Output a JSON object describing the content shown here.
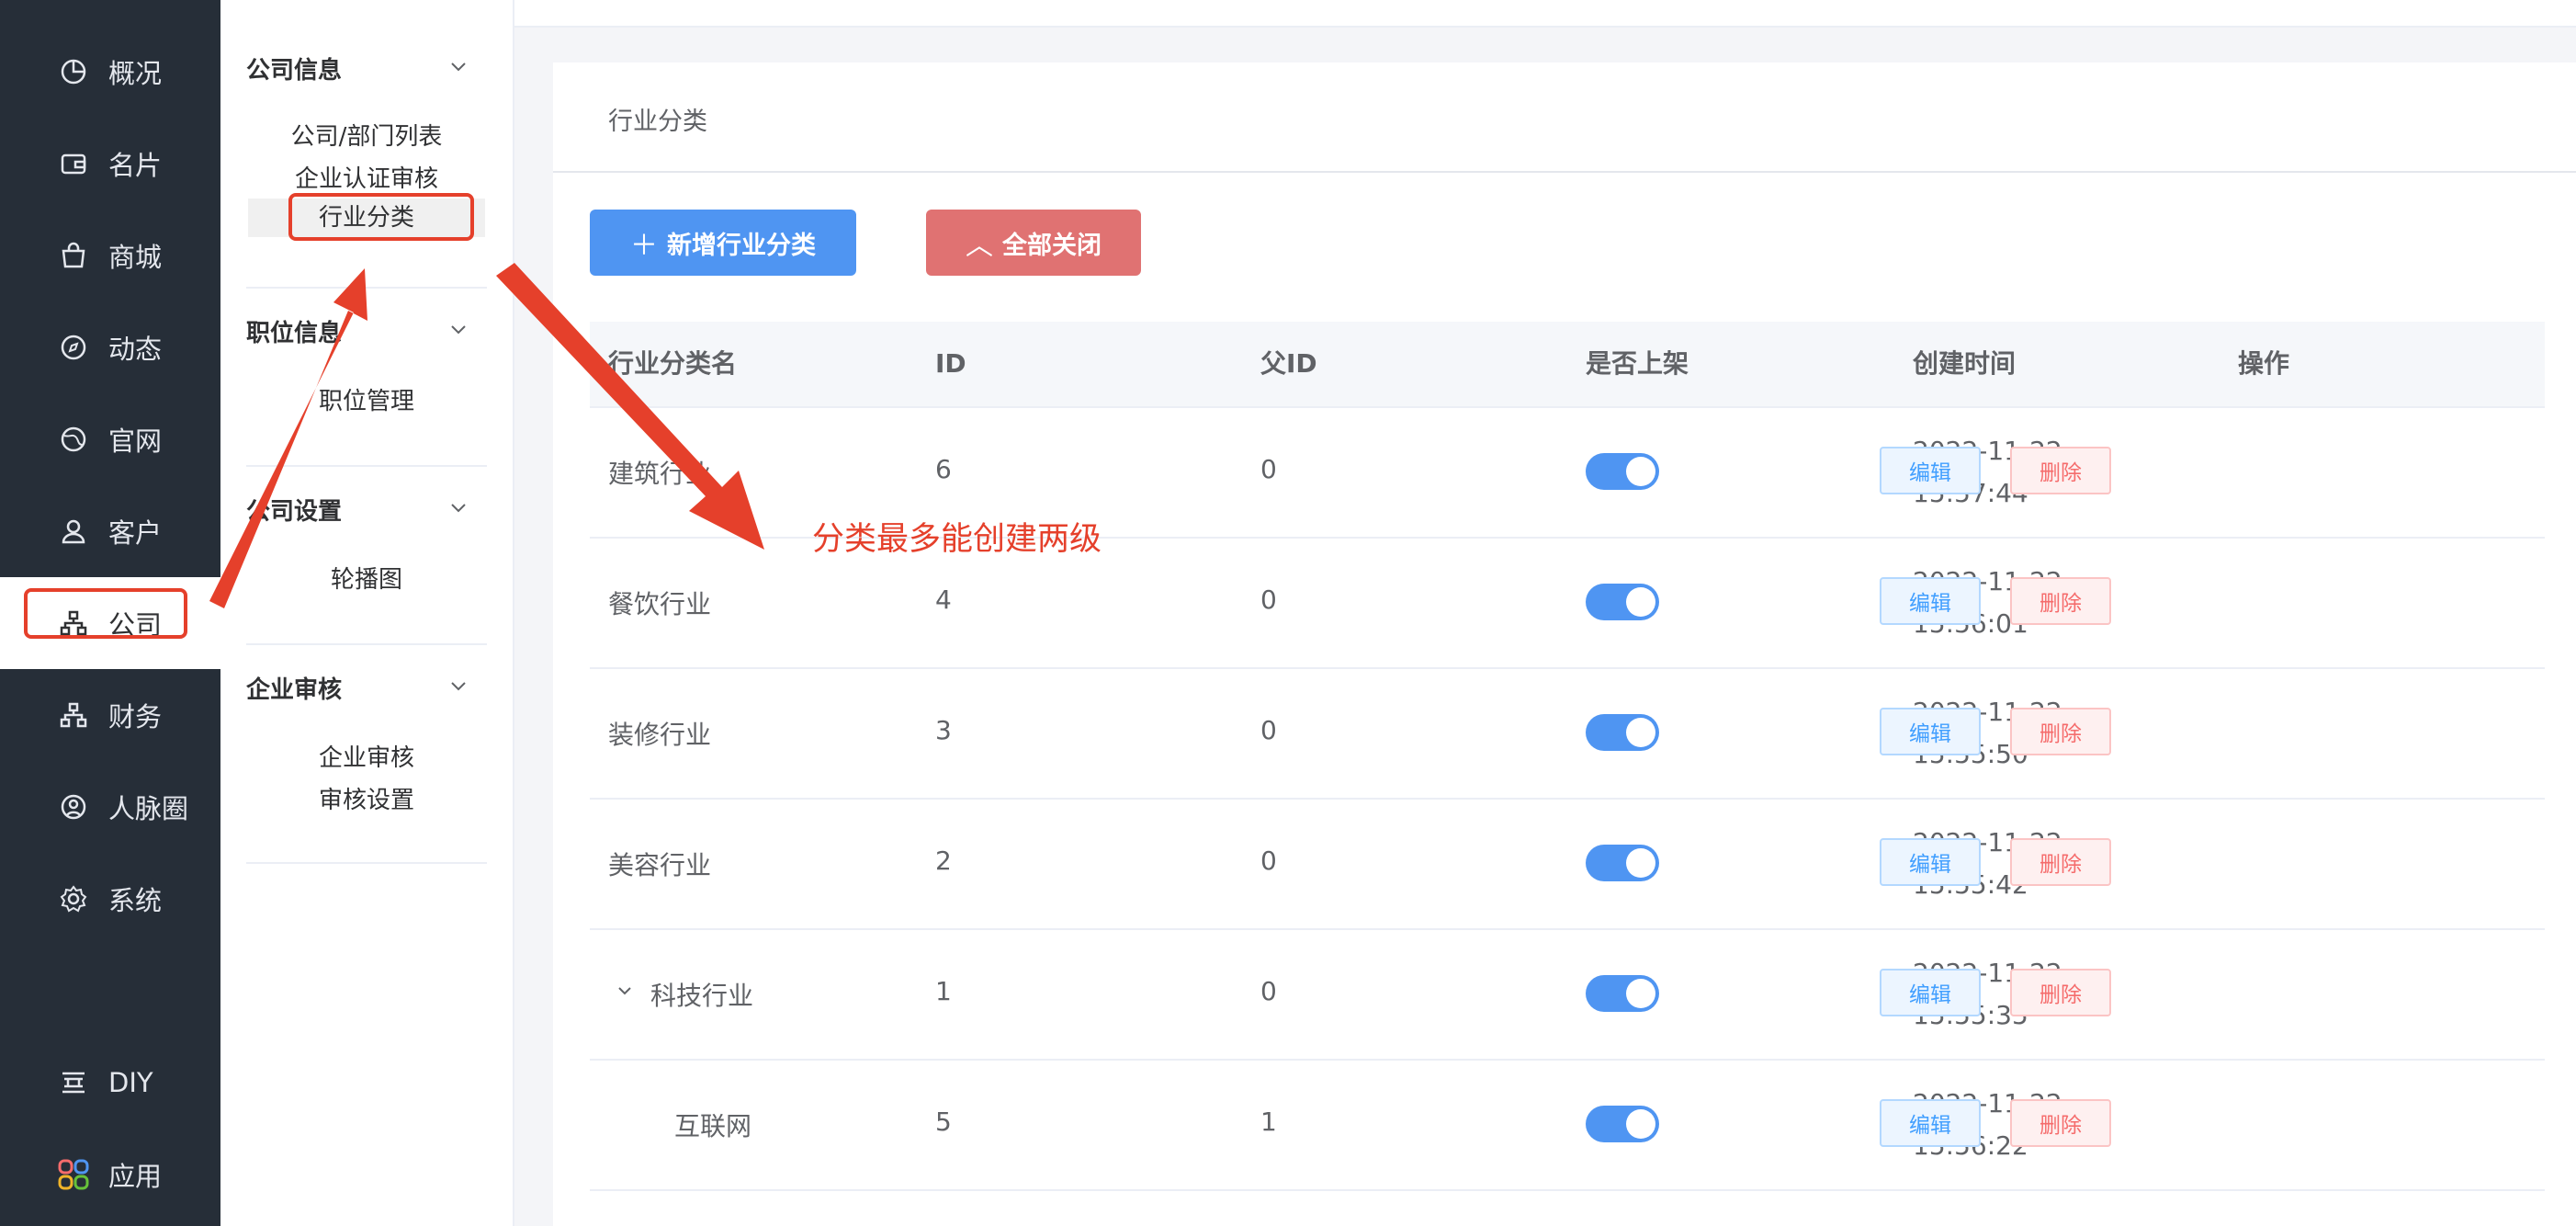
{
  "rail": {
    "items": [
      {
        "label": "概况",
        "icon": "pie-chart-icon"
      },
      {
        "label": "名片",
        "icon": "wallet-icon"
      },
      {
        "label": "商城",
        "icon": "shopping-bag-icon"
      },
      {
        "label": "动态",
        "icon": "compass-icon"
      },
      {
        "label": "官网",
        "icon": "globe-icon"
      },
      {
        "label": "客户",
        "icon": "user-icon"
      },
      {
        "label": "公司",
        "icon": "org-chart-icon"
      },
      {
        "label": "财务",
        "icon": "org-chart-icon"
      },
      {
        "label": "人脉圈",
        "icon": "user-circle-icon"
      },
      {
        "label": "系统",
        "icon": "gear-icon"
      }
    ],
    "bottom": [
      {
        "label": "DIY",
        "icon": "layout-icon"
      },
      {
        "label": "应用",
        "icon": "apps-icon"
      }
    ],
    "active": "公司"
  },
  "submenu": {
    "groups": [
      {
        "title": "公司信息",
        "items": [
          "公司/部门列表",
          "企业认证审核",
          "行业分类"
        ]
      },
      {
        "title": "职位信息",
        "items": [
          "职位管理"
        ]
      },
      {
        "title": "公司设置",
        "items": [
          "轮播图"
        ]
      },
      {
        "title": "企业审核",
        "items": [
          "企业审核",
          "审核设置"
        ]
      }
    ],
    "selected": "行业分类"
  },
  "panel": {
    "title": "行业分类",
    "add_button": "新增行业分类",
    "add_icon": "＋",
    "close_button": "全部关闭",
    "close_icon": "︿"
  },
  "table": {
    "headers": [
      "行业分类名",
      "ID",
      "父ID",
      "是否上架",
      "创建时间",
      "操作"
    ],
    "rows": [
      {
        "name": "建筑行业",
        "id": "6",
        "pid": "0",
        "on": true,
        "date": "2022-11-22",
        "time": "15:57:44"
      },
      {
        "name": "餐饮行业",
        "id": "4",
        "pid": "0",
        "on": true,
        "date": "2022-11-22",
        "time": "15:56:01"
      },
      {
        "name": "装修行业",
        "id": "3",
        "pid": "0",
        "on": true,
        "date": "2022-11-22",
        "time": "15:55:50"
      },
      {
        "name": "美容行业",
        "id": "2",
        "pid": "0",
        "on": true,
        "date": "2022-11-22",
        "time": "15:55:42"
      },
      {
        "name": "科技行业",
        "id": "1",
        "pid": "0",
        "on": true,
        "date": "2022-11-22",
        "time": "15:55:35"
      },
      {
        "name": "互联网",
        "id": "5",
        "pid": "1",
        "on": true,
        "date": "2022-11-22",
        "time": "15:56:22"
      }
    ],
    "edit_label": "编辑",
    "delete_label": "删除"
  },
  "annotation": {
    "note": "分类最多能创建两级",
    "color": "#e5402b"
  }
}
